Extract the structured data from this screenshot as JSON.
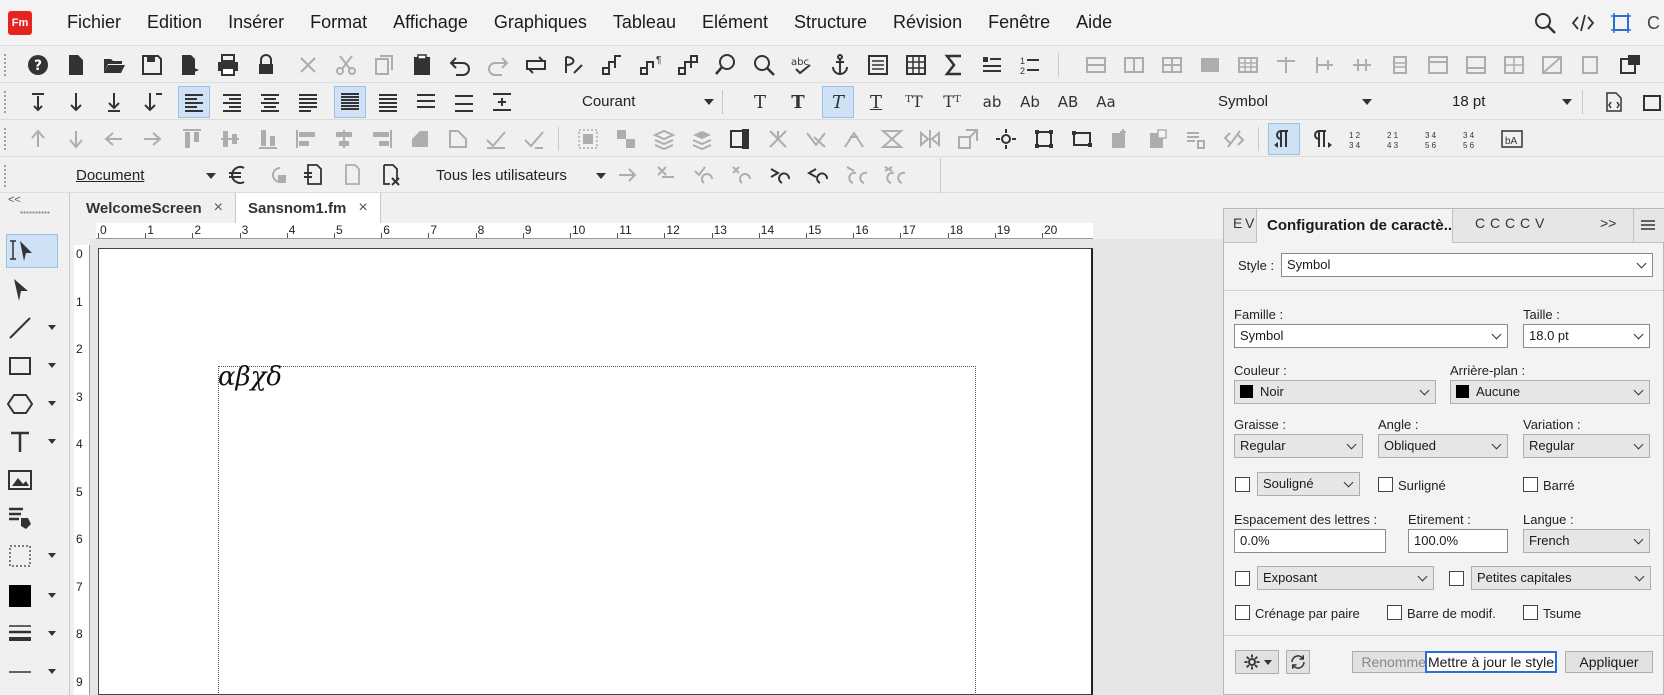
{
  "app": {
    "logo": "Fm",
    "accent": "#e5231f"
  },
  "menu": [
    "Fichier",
    "Edition",
    "Insérer",
    "Format",
    "Affichage",
    "Graphiques",
    "Tableau",
    "Elément",
    "Structure",
    "Révision",
    "Fenêtre",
    "Aide"
  ],
  "menu_right_letter": "C",
  "format_bar": {
    "paragraph_tag": "Courant",
    "char_buttons": [
      "T",
      "T",
      "T",
      "T",
      "ᵀT",
      "Tᵀ",
      "ab",
      "Ab",
      "AB",
      "Aa"
    ],
    "char_tag": "Symbol",
    "size": "18 pt"
  },
  "tracking_bar": {
    "view": "Document",
    "users": "Tous les utilisateurs"
  },
  "doc_tabs": [
    {
      "label": "WelcomeScreen",
      "close": "×"
    },
    {
      "label": "Sansnom1.fm",
      "close": "×"
    }
  ],
  "ruler": {
    "h_numbers": [
      "0",
      "1",
      "2",
      "3",
      "4",
      "5",
      "6",
      "7",
      "8",
      "9",
      "10",
      "11",
      "12",
      "13",
      "14",
      "15",
      "16",
      "17",
      "18",
      "19",
      "20"
    ],
    "v_numbers": [
      "0",
      "1",
      "2",
      "3",
      "4",
      "5",
      "6",
      "7",
      "8",
      "9"
    ]
  },
  "document": {
    "text": "αβχδ"
  },
  "panel": {
    "tabs_left": [
      "E",
      "V"
    ],
    "active_tab": "Configuration de caractè...",
    "tabs_right": [
      "C",
      "C",
      "C",
      "C",
      "V"
    ],
    "more": ">>",
    "style_label": "Style :",
    "style_value": "Symbol",
    "family_label": "Famille :",
    "family_value": "Symbol",
    "size_label": "Taille :",
    "size_value": "18.0 pt",
    "color_label": "Couleur :",
    "color_value": "Noir",
    "background_label": "Arrière-plan :",
    "background_value": "Aucune",
    "weight_label": "Graisse :",
    "weight_value": "Regular",
    "angle_label": "Angle :",
    "angle_value": "Obliqued",
    "variation_label": "Variation :",
    "variation_value": "Regular",
    "underline_value": "Souligné",
    "overline_label": "Surligné",
    "strike_label": "Barré",
    "spacing_label": "Espacement des lettres :",
    "spacing_value": "0.0%",
    "stretch_label": "Etirement :",
    "stretch_value": "100.0%",
    "language_label": "Langue :",
    "language_value": "French",
    "superscript_value": "Exposant",
    "smallcaps_value": "Petites capitales",
    "kerning_label": "Crénage par paire",
    "changebar_label": "Barre de modif.",
    "tsume_label": "Tsume",
    "rename_button": "Renommer",
    "update_button": "Mettre à jour le style",
    "apply_button": "Appliquer"
  }
}
